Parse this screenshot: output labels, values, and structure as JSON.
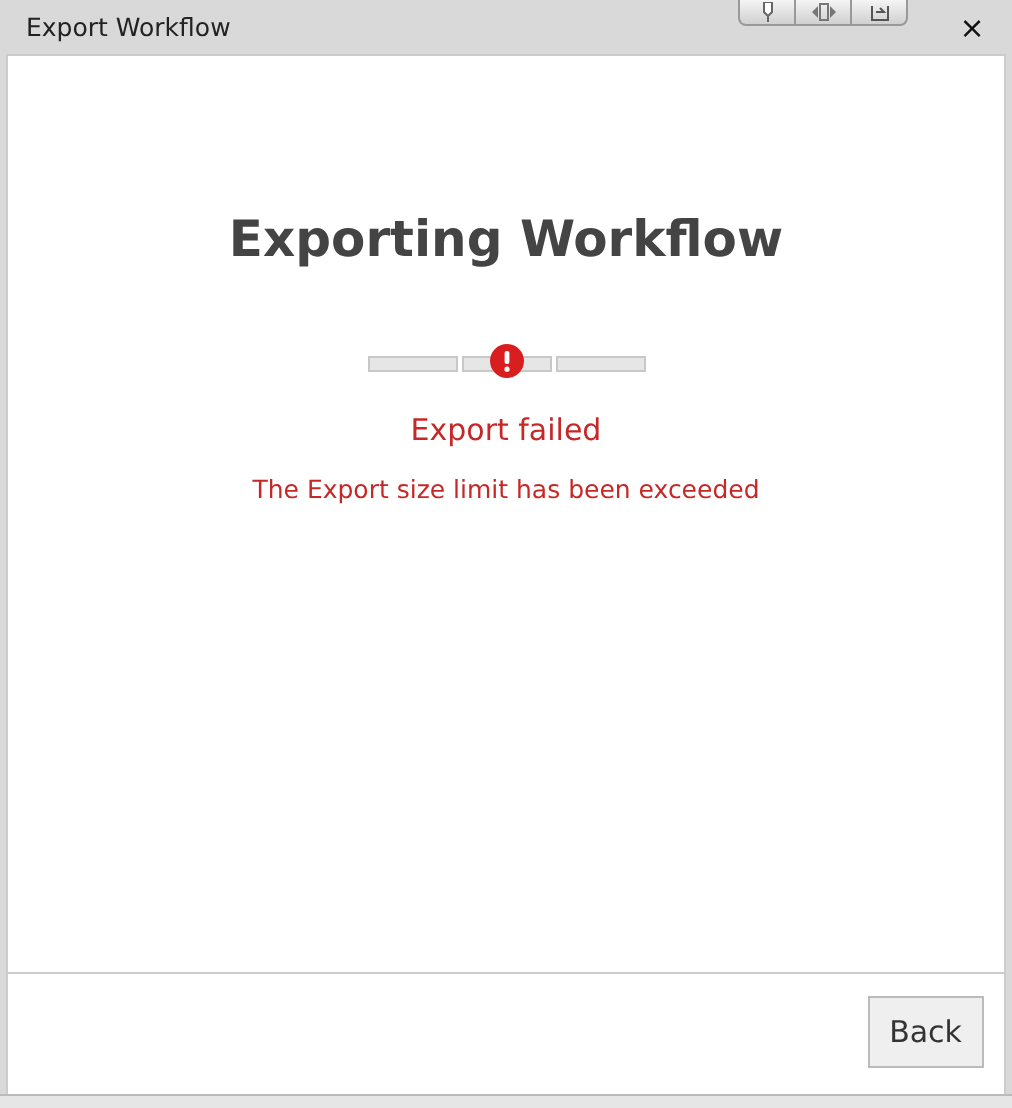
{
  "window": {
    "title": "Export Workflow",
    "close": "×"
  },
  "heading": "Exporting Workflow",
  "progress": {
    "steps": [
      {
        "kind": "segment"
      },
      {
        "kind": "error"
      },
      {
        "kind": "segment"
      }
    ]
  },
  "status": "Export failed",
  "message": "The Export size limit has been exceeded",
  "buttons": [
    "Back"
  ]
}
